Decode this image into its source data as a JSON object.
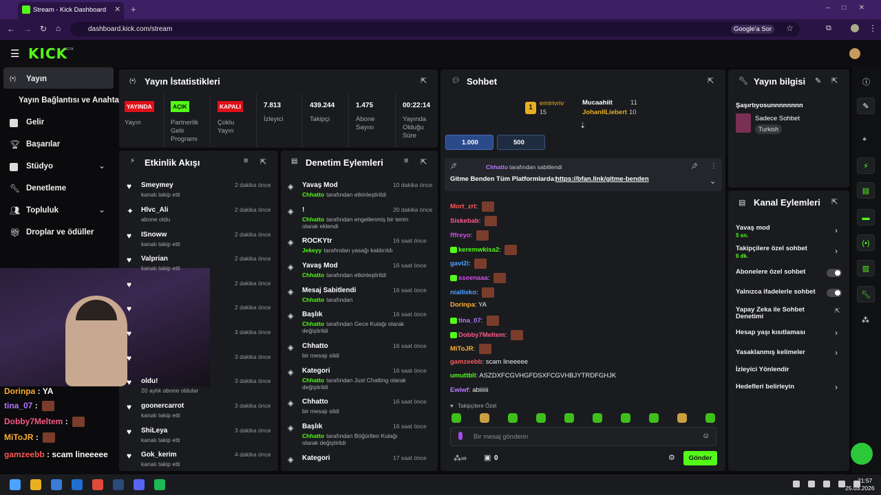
{
  "browser": {
    "tab_title": "Stream - Kick Dashboard",
    "url": "dashboard.kick.com/stream",
    "google_btn": "Google'a Sor"
  },
  "header": {
    "logo": "KICK",
    "beta": "BETA"
  },
  "sidebar": {
    "items": [
      {
        "label": "Yayın"
      },
      {
        "label": "Yayın Bağlantısı ve Anahtarı"
      },
      {
        "label": "Gelir"
      },
      {
        "label": "Başarılar"
      },
      {
        "label": "Stüdyo"
      },
      {
        "label": "Denetleme"
      },
      {
        "label": "Topluluk"
      },
      {
        "label": "Droplar ve ödüller"
      }
    ]
  },
  "stats": {
    "title": "Yayın İstatistikleri",
    "badges": [
      {
        "label": "YAYINDA",
        "caption": "Yayın"
      },
      {
        "label": "AÇIK",
        "caption": "Partnerlik Gelir Programı"
      },
      {
        "label": "KAPALI",
        "caption": "Çoklu Yayın"
      }
    ],
    "metrics": [
      {
        "value": "7.813",
        "label": "İzleyici"
      },
      {
        "value": "439.244",
        "label": "Takipçi"
      },
      {
        "value": "1.475",
        "label": "Abone Sayısı"
      },
      {
        "value": "00:22:14",
        "label": "Yayında Olduğu Süre"
      }
    ]
  },
  "activity": {
    "title": "Etkinlik Akışı",
    "items": [
      {
        "name": "Smeymey",
        "sub": "kanalı takip etti",
        "time": "2 dakika önce"
      },
      {
        "name": "Hlvc_Ali",
        "sub": "abone oldu",
        "time": "2 dakika önce"
      },
      {
        "name": "ISnoww",
        "sub": "kanalı takip etti",
        "time": "2 dakika önce"
      },
      {
        "name": "Valprian",
        "sub": "kanalı takip etti",
        "time": "2 dakika önce"
      },
      {
        "name": "",
        "sub": "",
        "time": "2 dakika önce"
      },
      {
        "name": "",
        "sub": "",
        "time": "2 dakika önce"
      },
      {
        "name": "",
        "sub": "",
        "time": "3 dakika önce"
      },
      {
        "name": "",
        "sub": "",
        "time": "3 dakika önce"
      },
      {
        "name": "oldu!",
        "sub": "20 aylık abone oldular",
        "time": "3 dakika önce"
      },
      {
        "name": "goonercarrot",
        "sub": "kanalı takip etti",
        "time": "3 dakika önce"
      },
      {
        "name": "ShiLeya",
        "sub": "kanalı takip etti",
        "time": "3 dakika önce"
      },
      {
        "name": "Gok_kerim",
        "sub": "kanalı takip etti",
        "time": "4 dakika önce"
      }
    ]
  },
  "moderation": {
    "title": "Denetim Eylemleri",
    "items": [
      {
        "name": "Yavaş Mod",
        "actor": "Chhatto",
        "sub": "tarafından etkinleştirildi",
        "time": "10 dakika önce"
      },
      {
        "name": "!",
        "actor": "Chhatto",
        "sub": "tarafından engellenmiş bir terim olarak eklendi",
        "time": "20 dakika önce"
      },
      {
        "name": "ROCKYtr",
        "actor": "Jekeyy",
        "sub": "tarafından yasağı kaldırıldı",
        "time": "16 saat önce"
      },
      {
        "name": "Yavaş Mod",
        "actor": "Chhatto",
        "sub": "tarafından etkinleştirildi",
        "time": "16 saat önce"
      },
      {
        "name": "Mesaj Sabitlendi",
        "actor": "Chhatto",
        "sub": "tarafından",
        "time": "16 saat önce"
      },
      {
        "name": "Başlık",
        "actor": "Chhatto",
        "sub": "tarafından Gece Kulağı olarak değiştirildi",
        "time": "16 saat önce"
      },
      {
        "name": "Chhatto",
        "actor": "",
        "sub": "bir mesajı sildi",
        "time": "16 saat önce"
      },
      {
        "name": "Kategori",
        "actor": "Chhatto",
        "sub": "tarafından Just Chatting olarak değiştirildi",
        "time": "16 saat önce"
      },
      {
        "name": "Chhatto",
        "actor": "",
        "sub": "bir mesajı sildi",
        "time": "16 saat önce"
      },
      {
        "name": "Başlık",
        "actor": "Chhatto",
        "sub": "tarafından Böğürtlen Kulağı olarak değiştirildi",
        "time": "16 saat önce"
      },
      {
        "name": "Kategori",
        "actor": "",
        "sub": "",
        "time": "17 saat önce"
      }
    ]
  },
  "chat": {
    "title": "Sohbet",
    "leaders": [
      {
        "rank": "1",
        "name": "emirivriv",
        "count": "15"
      },
      {
        "name": "Mucaahiit",
        "count": "11"
      },
      {
        "name": "JohanIILiebert",
        "count": "10"
      }
    ],
    "goals": [
      "1.000",
      "500"
    ],
    "pinned": {
      "by": "Chhatto",
      "by_text": "tarafından sabitlendi",
      "text": "Gitme Benden Tüm Platformlarda:",
      "link": "https://bfan.link/gitme-benden"
    },
    "messages": [
      {
        "user": "Mort_zrt",
        "color": "#ff5a5a",
        "text": ""
      },
      {
        "user": "Siskebab",
        "color": "#ff5a8a",
        "text": ""
      },
      {
        "user": "fffreyo",
        "color": "#d04be8",
        "text": ""
      },
      {
        "user": "keremwkisa2",
        "color": "#53fc18",
        "text": ""
      },
      {
        "user": "gavi2i",
        "color": "#4aa3ff",
        "text": ""
      },
      {
        "user": "sseenaaa",
        "color": "#d04be8",
        "text": ""
      },
      {
        "user": "niallisko",
        "color": "#4aa3ff",
        "text": ""
      },
      {
        "user": "Dorinpa",
        "color": "#ffb02e",
        "text": "YA"
      },
      {
        "user": "tina_07",
        "color": "#b77bff",
        "text": ""
      },
      {
        "user": "Dobby7Meltem",
        "color": "#ff5a8a",
        "text": ""
      },
      {
        "user": "MiToJR",
        "color": "#ffb02e",
        "text": ""
      },
      {
        "user": "gamzeebb",
        "color": "#ff5a5a",
        "text": "scam lineeeee"
      },
      {
        "user": "umuttbll",
        "color": "#53fc18",
        "text": "ASZDXFCGVHGFDSXFCGVHBJYTRDFGHJK"
      },
      {
        "user": "Ewiwf",
        "color": "#b77bff",
        "text": "abiiiiii"
      }
    ],
    "followers_only": "Takipçilere Özel",
    "input_placeholder": "Bir mesaj gönderin",
    "points": "0",
    "send": "Gönder"
  },
  "overlay_chat": [
    {
      "user": "Dorinpa",
      "text": "YA"
    },
    {
      "user": "tina_07",
      "text": ""
    },
    {
      "user": "Dobby7Meltem",
      "text": ""
    },
    {
      "user": "MiToJR",
      "text": ""
    },
    {
      "user": "gamzeebb",
      "text": "scam lineeeee"
    },
    {
      "user": "umuttbll",
      "text": "ASZDXFCGVHGFDSXFCGVHBJYTRDFGHJK"
    }
  ],
  "streaminfo": {
    "title": "Yayın bilgisi",
    "stream_title": "Şaşırtıyosunnnnnnnn",
    "category": "Sadece Sohbet",
    "language": "Turkish"
  },
  "channel_actions": {
    "title": "Kanal Eylemleri",
    "items": [
      {
        "label": "Yavaş mod",
        "sub": "5 sn.",
        "kind": "chevron"
      },
      {
        "label": "Takipçilere özel sohbet",
        "sub": "6 dk.",
        "kind": "chevron"
      },
      {
        "label": "Abonelere özel sohbet",
        "sub": "",
        "kind": "toggle"
      },
      {
        "label": "Yalnızca ifadelerle sohbet",
        "sub": "",
        "kind": "toggle"
      },
      {
        "label": "Yapay Zeka ile Sohbet Denetimi",
        "sub": "",
        "kind": "link"
      },
      {
        "label": "Hesap yaşı kısıtlaması",
        "sub": "",
        "kind": "chevron"
      },
      {
        "label": "Yasaklanmış kelimeler",
        "sub": "",
        "kind": "chevron"
      },
      {
        "label": "İzleyici Yönlendir",
        "sub": "",
        "kind": "none"
      },
      {
        "label": "Hedefleri belirleyin",
        "sub": "",
        "kind": "chevron"
      }
    ]
  },
  "taskbar": {
    "time": "21:57",
    "date": "25.03.2026"
  }
}
